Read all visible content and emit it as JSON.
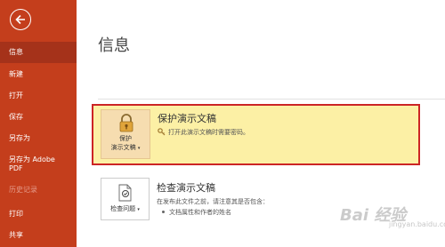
{
  "sidebar": {
    "items": [
      {
        "label": "信息"
      },
      {
        "label": "新建"
      },
      {
        "label": "打开"
      },
      {
        "label": "保存"
      },
      {
        "label": "另存为"
      },
      {
        "label": "另存为 Adobe"
      },
      {
        "label": "PDF"
      },
      {
        "label": "历史记录"
      },
      {
        "label": "打印"
      },
      {
        "label": "共享"
      }
    ]
  },
  "page": {
    "title": "信息"
  },
  "protect": {
    "button_line1": "保护",
    "button_line2": "演示文稿",
    "title": "保护演示文稿",
    "description": "打开此演示文稿时需要密码。"
  },
  "inspect": {
    "button_label": "检查问题",
    "title": "检查演示文稿",
    "description": "在发布此文件之前，请注意其是否包含：",
    "bullet": "文档属性和作者的姓名"
  },
  "watermark": {
    "text": "Bai 经验",
    "sub": "jingyan.baidu.com"
  },
  "colors": {
    "sidebar": "#c43e1c",
    "selected": "#a5321a",
    "highlight": "#fcf0a5",
    "highlight_border": "#cc2525"
  }
}
